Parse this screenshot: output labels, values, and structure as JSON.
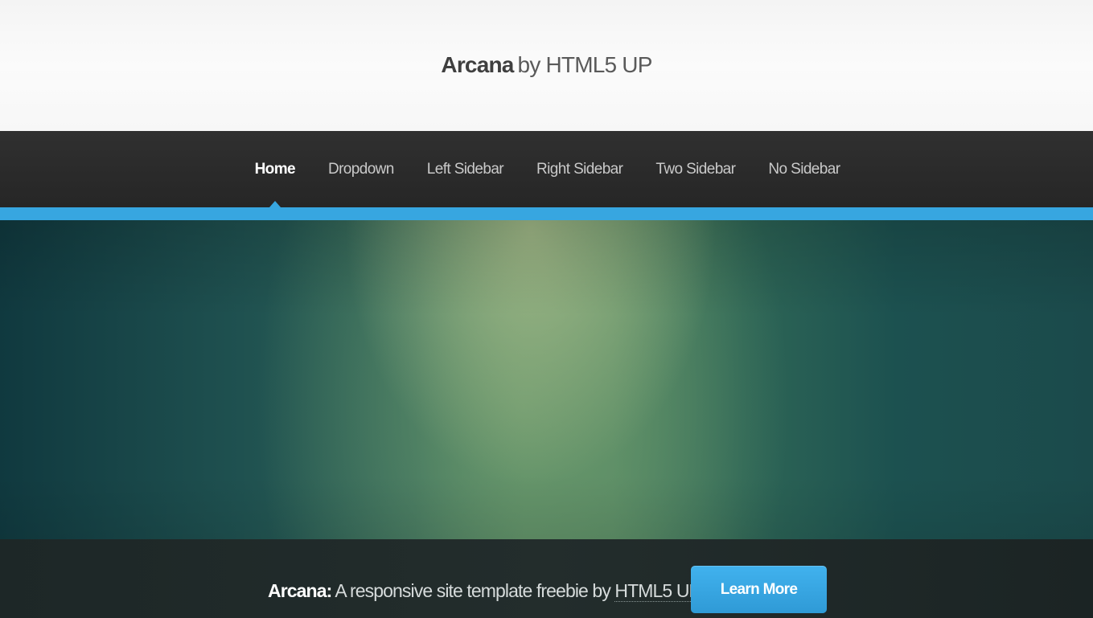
{
  "header": {
    "logo_name": "Arcana",
    "logo_suffix": "by HTML5 UP"
  },
  "nav": {
    "items": [
      {
        "label": "Home",
        "current": true
      },
      {
        "label": "Dropdown",
        "current": false
      },
      {
        "label": "Left Sidebar",
        "current": false
      },
      {
        "label": "Right Sidebar",
        "current": false
      },
      {
        "label": "Two Sidebar",
        "current": false
      },
      {
        "label": "No Sidebar",
        "current": false
      }
    ]
  },
  "cta": {
    "title": "Arcana:",
    "text": "A responsive site template freebie by",
    "link": "HTML5 UP",
    "button": "Learn More"
  },
  "colors": {
    "accent": "#37a6e0",
    "nav_bg": "#2b2b2b",
    "header_bg": "#f7f7f7",
    "cta_bg": "#1f2929"
  }
}
